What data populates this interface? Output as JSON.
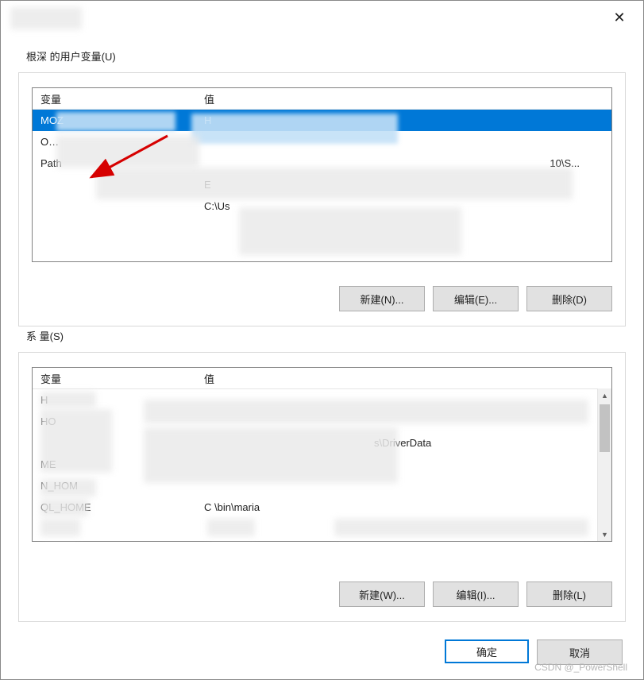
{
  "dialog": {
    "title": "",
    "close_tooltip": "关闭"
  },
  "user_section": {
    "legend": "根深 的用户变量(U)",
    "col_name": "变量",
    "col_value": "值",
    "rows": [
      {
        "name": "MOZ",
        "value": "H",
        "selected": true
      },
      {
        "name": "O…",
        "value": ""
      },
      {
        "name": "Path",
        "value": "10\\S..."
      },
      {
        "name": "",
        "value": "E"
      },
      {
        "name": "",
        "value": "C:\\Us"
      }
    ],
    "btn_new": "新建(N)...",
    "btn_edit": "编辑(E)...",
    "btn_del": "删除(D)"
  },
  "sys_section": {
    "legend": "系          量(S)",
    "col_name": "变量",
    "col_value": "值",
    "rows": [
      {
        "name": "        H",
        "value": ""
      },
      {
        "name": "      HO",
        "value": ""
      },
      {
        "name": "",
        "value": "s\\DriverData"
      },
      {
        "name": "      ME",
        "value": ""
      },
      {
        "name": "     N_HOM",
        "value": ""
      },
      {
        "name": "     QL_HOME",
        "value": "C           \\bin\\maria"
      }
    ],
    "btn_new": "新建(W)...",
    "btn_edit": "编辑(I)...",
    "btn_del": "删除(L)"
  },
  "dialog_btns": {
    "ok": "确定",
    "cancel": "取消"
  },
  "watermark": "CSDN @_PowerShell"
}
